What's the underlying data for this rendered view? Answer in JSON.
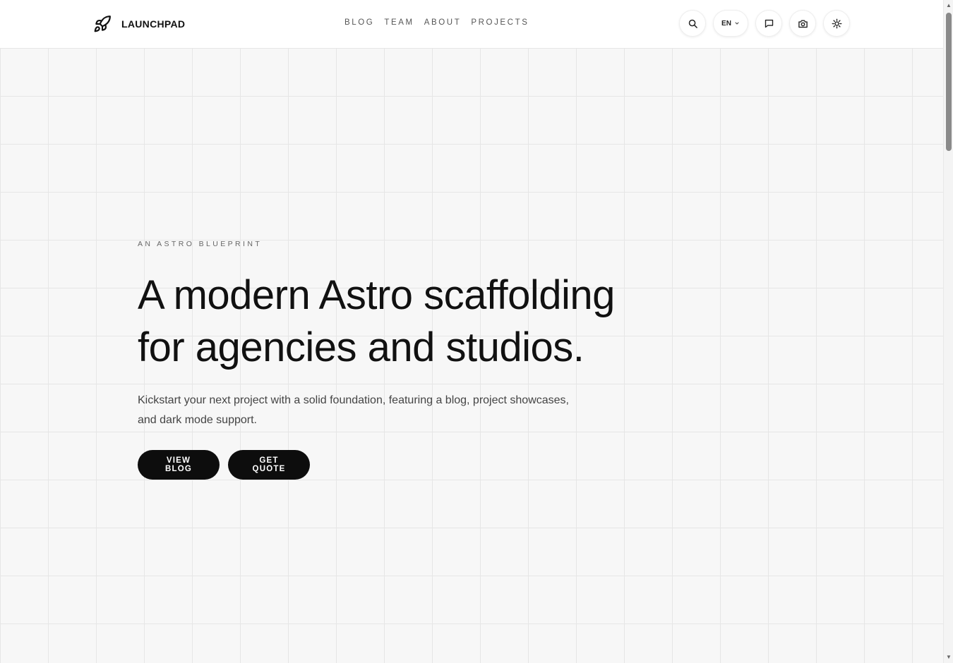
{
  "header": {
    "brand_name": "LAUNCHPAD",
    "nav": [
      {
        "label": "BLOG"
      },
      {
        "label": "TEAM"
      },
      {
        "label": "ABOUT"
      },
      {
        "label": "PROJECTS"
      }
    ],
    "language": "EN",
    "icons": [
      "rocket-icon",
      "search-icon",
      "chevron-down-icon",
      "chat-icon",
      "camera-icon",
      "sun-icon"
    ]
  },
  "hero": {
    "eyebrow": "AN ASTRO BLUEPRINT",
    "title_line1": "A modern Astro scaffolding",
    "title_line2": "for agencies and studios.",
    "description": "Kickstart your next project with a solid foundation, featuring a blog, project showcases, and dark mode support.",
    "cta_primary": "VIEW BLOG",
    "cta_secondary": "GET QUOTE"
  },
  "colors": {
    "background": "#f7f7f7",
    "grid_line": "#e6e6e6",
    "button": "#0d0d0d",
    "text": "#111111"
  }
}
